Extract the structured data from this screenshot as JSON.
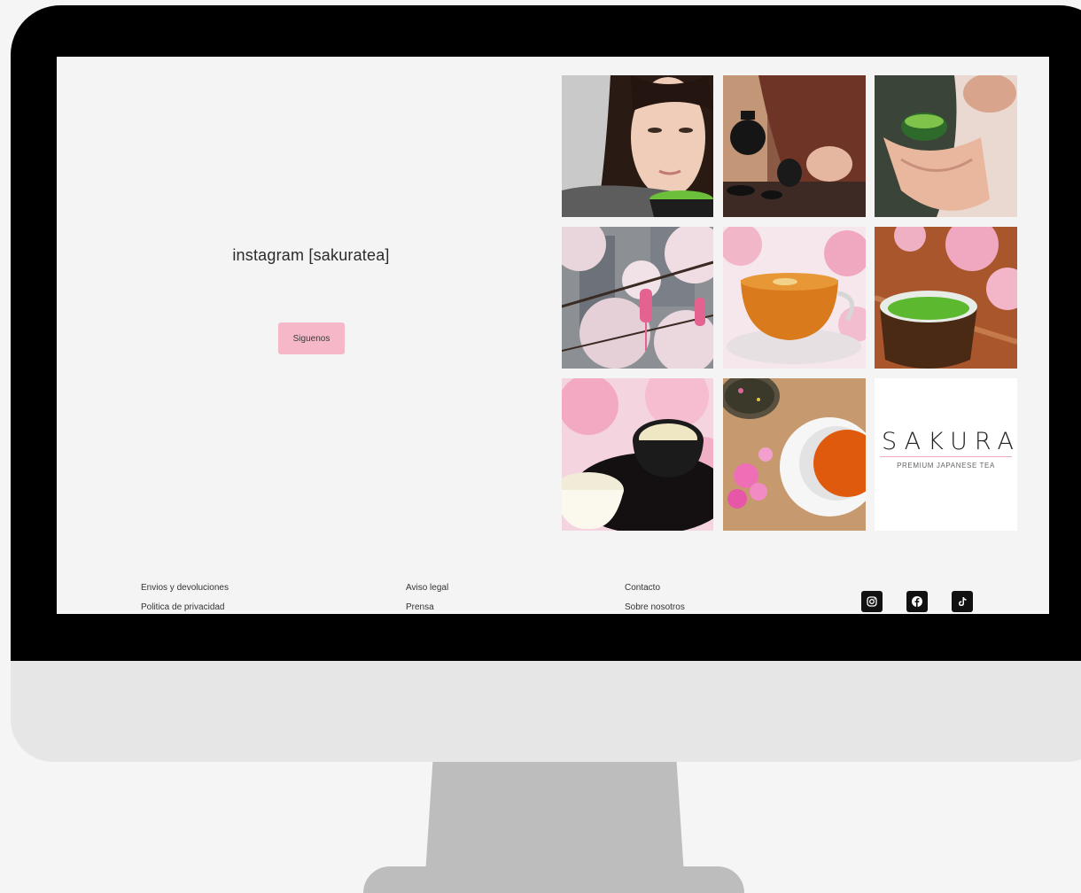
{
  "instagram": {
    "title": "instagram [sakuratea]",
    "follow_label": "Siguenos"
  },
  "gallery": {
    "logo": {
      "word": "SAKURA",
      "tagline": "PREMIUM JAPANESE TEA"
    }
  },
  "footer": {
    "col1": [
      "Envios y devoluciones",
      "Politica de privacidad"
    ],
    "col2": [
      "Aviso legal",
      "Prensa"
    ],
    "col3": [
      "Contacto",
      "Sobre nosotros"
    ],
    "social": [
      "instagram-icon",
      "facebook-icon",
      "tiktok-icon"
    ]
  },
  "colors": {
    "accent_pink": "#f6b8c8",
    "bezel": "#000000",
    "screen_bg": "#f4f4f4"
  }
}
